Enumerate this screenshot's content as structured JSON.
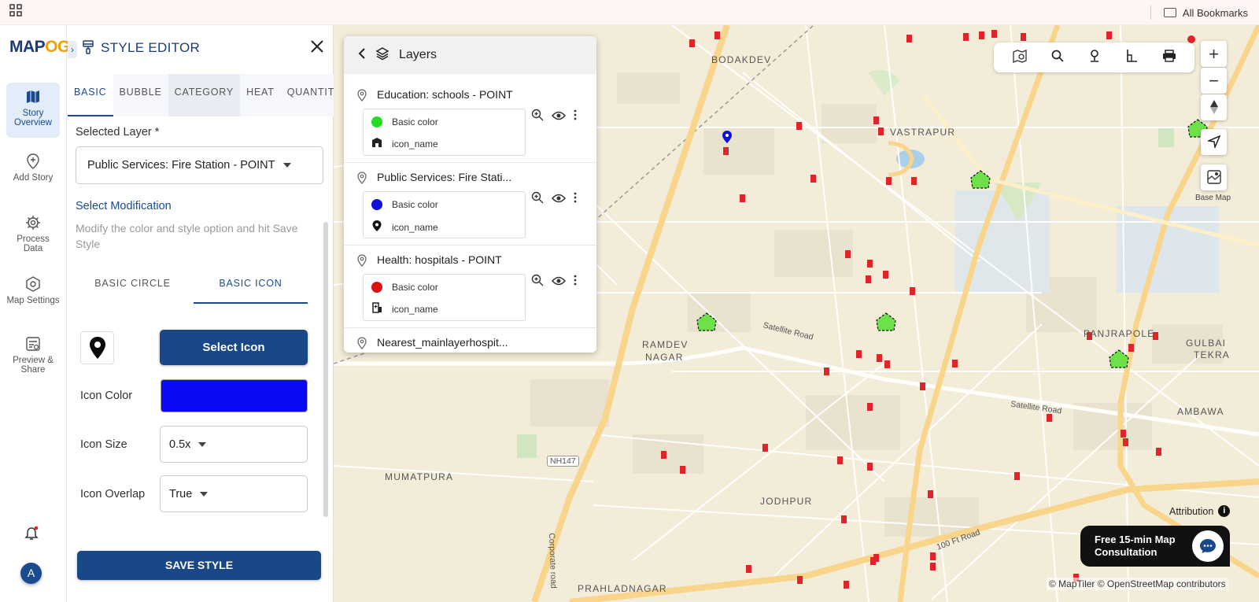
{
  "browser": {
    "bookmarks_label": "All Bookmarks"
  },
  "logo": {
    "part1": "MAP",
    "part2": "OG"
  },
  "rail": {
    "items": [
      {
        "label": "Story Overview",
        "icon": "map-icon"
      },
      {
        "label": "Add Story",
        "icon": "add-location-icon"
      },
      {
        "label": "Process Data",
        "icon": "gear-icon"
      },
      {
        "label": "Map Settings",
        "icon": "settings-icon"
      },
      {
        "label": "Preview & Share",
        "icon": "preview-icon"
      }
    ],
    "avatar_initial": "A"
  },
  "editor": {
    "title": "STYLE EDITOR",
    "tabs": [
      "BASIC",
      "BUBBLE",
      "CATEGORY",
      "HEAT",
      "QUANTITY"
    ],
    "selected_layer_label": "Selected Layer *",
    "selected_layer_value": "Public Services: Fire Station - POINT",
    "modification_title": "Select Modification",
    "modification_desc": "Modify the color and style option and hit Save Style",
    "subtabs": [
      "BASIC CIRCLE",
      "BASIC ICON"
    ],
    "select_icon_label": "Select Icon",
    "icon_color_label": "Icon Color",
    "icon_color": "#0a0af2",
    "icon_size_label": "Icon Size",
    "icon_size_value": "0.5x",
    "icon_overlap_label": "Icon Overlap",
    "icon_overlap_value": "True",
    "save_label": "SAVE STYLE"
  },
  "layers_panel": {
    "title": "Layers",
    "layers": [
      {
        "name": "Education: schools - POINT",
        "color_label": "Basic color",
        "color": "#22dd22",
        "icon_label": "icon_name",
        "icon": "school-icon"
      },
      {
        "name": "Public Services: Fire Stati...",
        "color_label": "Basic color",
        "color": "#1111dd",
        "icon_label": "icon_name",
        "icon": "map-pin-icon"
      },
      {
        "name": "Health: hospitals - POINT",
        "color_label": "Basic color",
        "color": "#dd1111",
        "icon_label": "icon_name",
        "icon": "hospital-icon"
      },
      {
        "name": "Nearest_mainlayerhospit..."
      }
    ]
  },
  "map": {
    "places": [
      "BODAKDEV",
      "VASTRAPUR",
      "RAMDEV",
      "NAGAR",
      "MUMATPURA",
      "JODHPUR",
      "PANJRAPOLE",
      "GULBAI",
      "TEKRA",
      "AMBAWA",
      "PRAHLADNAGAR"
    ],
    "roads": [
      "Satellite Road",
      "Satellite Road",
      "NH147",
      "Corporate road",
      "100 Ft Road"
    ],
    "basemap_label": "Base Map",
    "attribution_label": "Attribution",
    "consult_line1": "Free 15-min Map",
    "consult_line2": "Consultation",
    "copyright": "© MapTiler © OpenStreetMap contributors"
  }
}
